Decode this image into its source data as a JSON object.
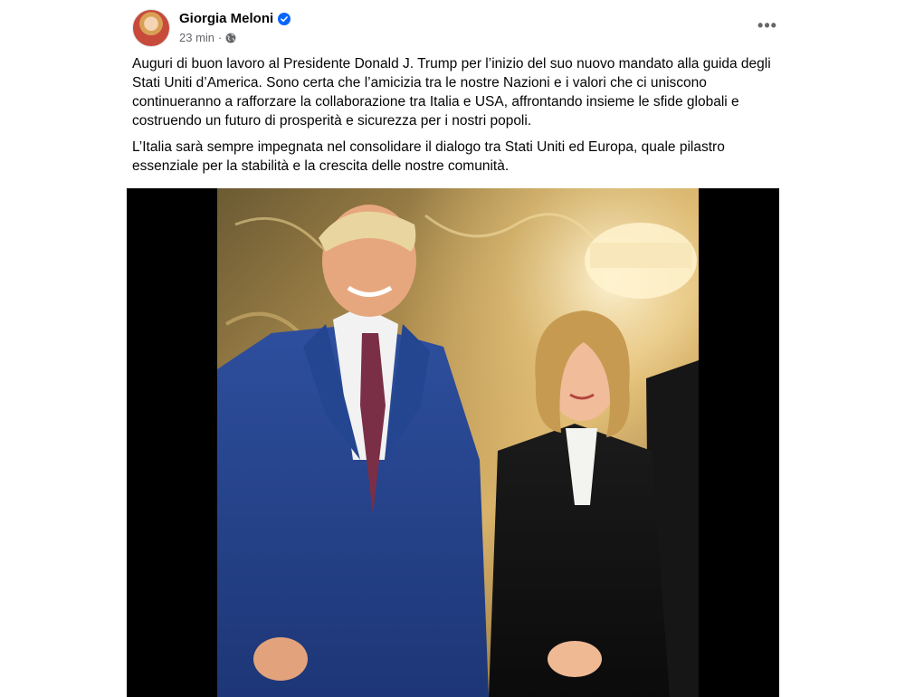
{
  "post": {
    "author": "Giorgia Meloni",
    "time": "23 min",
    "more_label": "•••",
    "icons": {
      "verified": "verified-badge-icon",
      "audience": "globe-icon",
      "more": "more-options-icon"
    },
    "paragraphs": [
      "Auguri di buon lavoro al Presidente Donald J. Trump per l’inizio del suo nuovo mandato alla guida degli Stati Uniti d’America. Sono certa che l’amicizia tra le nostre Nazioni e i valori che ci uniscono continueranno a rafforzare la collaborazione tra Italia e USA, affrontando insieme le sfide globali e costruendo un futuro di prosperità e sicurezza per i nostri popoli.",
      "L’Italia sarà sempre impegnata nel consolidare il dialogo tra Stati Uniti ed Europa, quale pilastro essenziale per la stabilità e la crescita delle nostre comunità."
    ]
  },
  "colors": {
    "verified": "#0866ff",
    "text_primary": "#050505",
    "text_secondary": "#65676b",
    "media_background": "#000000"
  }
}
